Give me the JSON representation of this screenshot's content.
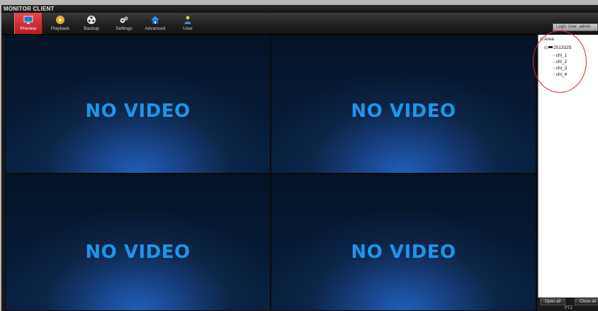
{
  "app": {
    "title": "MONITOR CLIENT"
  },
  "toolbar": {
    "items": [
      {
        "label": "Preview",
        "icon": "monitor-icon",
        "active": true
      },
      {
        "label": "Playback",
        "icon": "play-icon",
        "active": false
      },
      {
        "label": "Backup",
        "icon": "reel-icon",
        "active": false
      },
      {
        "label": "Settings",
        "icon": "gears-icon",
        "active": false
      },
      {
        "label": "Advanced",
        "icon": "house-icon",
        "active": false
      },
      {
        "label": "User",
        "icon": "user-icon",
        "active": false
      }
    ],
    "login": "Login User: admin"
  },
  "video": {
    "tiles": [
      {
        "text": "NO VIDEO"
      },
      {
        "text": "NO VIDEO"
      },
      {
        "text": "NO VIDEO"
      },
      {
        "text": "NO VIDEO"
      }
    ]
  },
  "tree": {
    "root": "Area",
    "device": "2513325",
    "channels": [
      "chl_1",
      "chl_2",
      "chl_3",
      "chl_4"
    ]
  },
  "side_buttons": {
    "open_all": "Open all",
    "close_all": "Close all",
    "ptz": "PTZ"
  },
  "colors": {
    "active_tab": "#d3292c",
    "no_video_text": "#1e95e8",
    "annotation_circle": "#e0262b"
  }
}
